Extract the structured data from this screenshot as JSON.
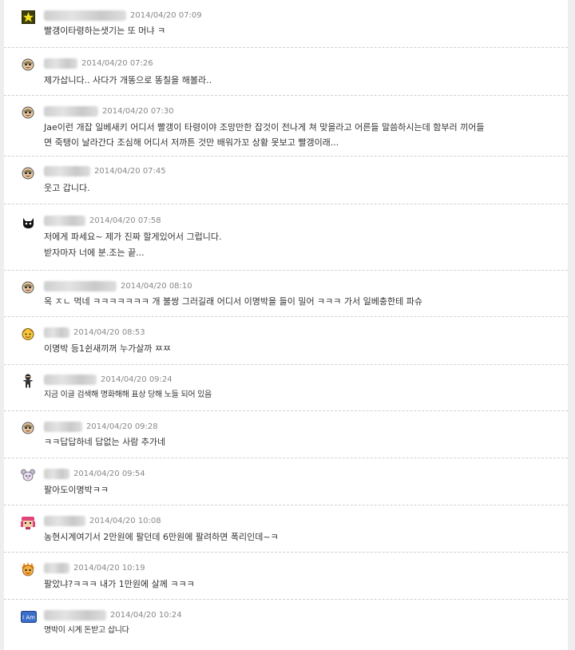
{
  "comments": [
    {
      "avatar": "star-badge-icon",
      "date": "2014/04/20 07:09",
      "text": "빨갱이타령하는샛기는 또 머냐 ㅋ"
    },
    {
      "avatar": "face-icon",
      "date": "2014/04/20 07:26",
      "text": "제가삽니다.. 사다가 개똥으로 똥칠을 해볼라.."
    },
    {
      "avatar": "face-icon",
      "date": "2014/04/20 07:30",
      "text": "Jae이런 개잡 일베새키 어디서 빨갱이 타령이야 조망만한 잡것이 전나게 쳐 맞을라고 어른들 말씀하시는데 함부러 끼어들\n면 죽탱이 날라간다 조심해 어디서 저까튼 것만 배워가꼬 상황 못보고 빨갱이래..."
    },
    {
      "avatar": "face-icon",
      "date": "2014/04/20 07:45",
      "text": "웃고 갑니다."
    },
    {
      "avatar": "black-cat-icon",
      "date": "2014/04/20 07:58",
      "text": "저에게 파세요~ 제가 진짜 할게있어서 그럽니다.\n받자마자 너에 분.조는 끝..."
    },
    {
      "avatar": "face-icon",
      "date": "2014/04/20 08:10",
      "text": "옥 ㅈㄴ 먹네 ㅋㅋㅋㅋㅋㅋㅋ 개 불쌍 그러길래 어디서 이명박을 들이 밀어 ㅋㅋㅋ 가서 일베충한테 파슈"
    },
    {
      "avatar": "yellow-face-icon",
      "date": "2014/04/20 08:53",
      "text": "이명박 등1쉰새끼꺼 누가살까 ㅉㅉ"
    },
    {
      "avatar": "ninja-icon",
      "date": "2014/04/20 09:24",
      "text": "지금 이글 검색해 명화해해 표상 당해 노들 되어 있음"
    },
    {
      "avatar": "face-icon",
      "date": "2014/04/20 09:28",
      "text": "ㅋㅋ답답하네 답없는 사람 추가네"
    },
    {
      "avatar": "mouse-icon",
      "date": "2014/04/20 09:54",
      "text": "팔아도이명박ㅋㅋ"
    },
    {
      "avatar": "pink-character-icon",
      "date": "2014/04/20 10:08",
      "text": "농현시계여기서 2만원에 팔던데 6만원에 팔려하면 폭리인데~ㅋ"
    },
    {
      "avatar": "orange-character-icon",
      "date": "2014/04/20 10:19",
      "text": "팔았냐?ㅋㅋㅋ 내가 1만원에 살께 ㅋㅋㅋ"
    },
    {
      "avatar": "i-am-badge-icon",
      "avatar_label": "I Am",
      "date": "2014/04/20 10:24",
      "text": "명박이 시계 돈받고 삽니다"
    }
  ]
}
